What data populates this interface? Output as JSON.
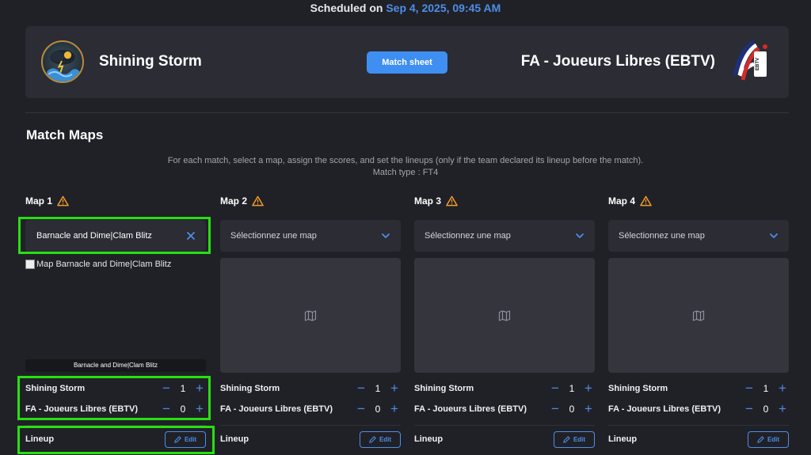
{
  "header": {
    "scheduled_prefix": "Scheduled on",
    "scheduled_date": "Sep 4, 2025, 09:45 AM"
  },
  "match": {
    "team_left": "Shining Storm",
    "team_right": "FA - Joueurs Libres (EBTV)",
    "match_sheet_label": "Match sheet"
  },
  "section": {
    "title": "Match Maps",
    "description": "For each match, select a map, assign the scores, and set the lineups (only if the team declared its lineup before the match).",
    "match_type": "Match type : FT4"
  },
  "maps": [
    {
      "title": "Map 1",
      "selected_map": "Barnacle and Dime|Clam Blitz",
      "image_alt": "Map Barnacle and Dime|Clam Blitz",
      "image_caption": "Barnacle and Dime|Clam Blitz",
      "score_team1": "Shining Storm",
      "score_val1": "1",
      "score_team2": "FA - Joueurs Libres (EBTV)",
      "score_val2": "0",
      "lineup_label": "Lineup",
      "edit_label": "Edit"
    },
    {
      "title": "Map 2",
      "placeholder": "Sélectionnez une map",
      "score_team1": "Shining Storm",
      "score_val1": "1",
      "score_team2": "FA - Joueurs Libres (EBTV)",
      "score_val2": "0",
      "lineup_label": "Lineup",
      "edit_label": "Edit"
    },
    {
      "title": "Map 3",
      "placeholder": "Sélectionnez une map",
      "score_team1": "Shining Storm",
      "score_val1": "1",
      "score_team2": "FA - Joueurs Libres (EBTV)",
      "score_val2": "0",
      "lineup_label": "Lineup",
      "edit_label": "Edit"
    },
    {
      "title": "Map 4",
      "placeholder": "Sélectionnez une map",
      "score_team1": "Shining Storm",
      "score_val1": "1",
      "score_team2": "FA - Joueurs Libres (EBTV)",
      "score_val2": "0",
      "lineup_label": "Lineup",
      "edit_label": "Edit"
    }
  ],
  "colors": {
    "accent": "#3f8ff2",
    "warning": "#f29b27",
    "highlight": "#27e011",
    "background": "#202127",
    "card": "#2b2c34"
  },
  "icons": {
    "warning": "warning-triangle-icon",
    "chevron": "chevron-down-icon",
    "clear": "close-icon",
    "placeholder_image": "map-icon",
    "edit": "pencil-icon",
    "minus": "minus-icon",
    "plus": "plus-icon"
  }
}
